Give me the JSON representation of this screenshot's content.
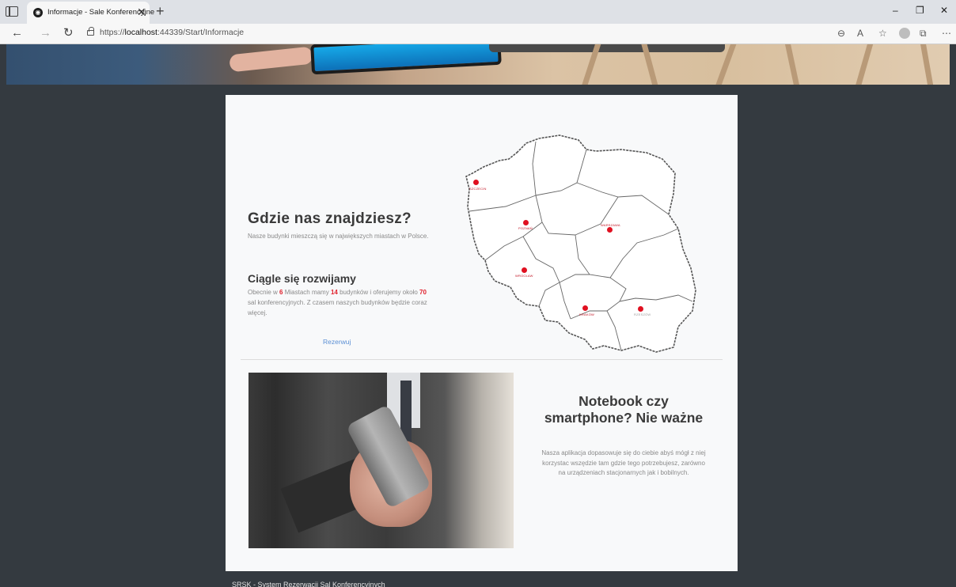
{
  "browser": {
    "tab_title": "Informacje - Sale Konferencyjne",
    "tab_close": "✕",
    "new_tab": "+",
    "url_prefix": "https://",
    "url_host": "localhost",
    "url_path": ":44339/Start/Informacje",
    "window_controls": {
      "minimize": "–",
      "restore": "❐",
      "close": "✕"
    },
    "toolbar_icons": [
      "zoom-icon",
      "read-aloud-icon",
      "favorites-icon",
      "collections-icon",
      "profile-icon",
      "more-icon"
    ]
  },
  "info": {
    "heading": "Gdzie nas znajdziesz?",
    "description": "Nasze budynki mieszczą się w największych miastach w Polsce.",
    "growth_heading": "Ciągle się rozwijamy",
    "growth_text": {
      "part1": "Obecnie w ",
      "cities_count": "6",
      "part2": " Miastach mamy ",
      "buildings_count": "14",
      "part3": " budynków i oferujemy około ",
      "rooms_count": "70",
      "part4": " sal konferencyjnych. Z czasem naszych budynków będzie coraz więcej."
    },
    "reserve_link": "Rezerwuj"
  },
  "map": {
    "cities": [
      "SZCZECIN",
      "POZNAŃ",
      "WARSZAWA",
      "WROCŁAW",
      "KRAKÓW",
      "RZESZÓW"
    ]
  },
  "device": {
    "heading": "Notebook czy smartphone? Nie ważne",
    "text": "Nasza aplikacja dopasowuje się do ciebie abyś mógł z niej korzystac wszędzie tam gdzie tego potrzebujesz, zarówno na urządzeniach stacjonarnych jak i bobilnych."
  },
  "footer": {
    "text": "SRSK - System Rezerwacji Sal Konferencyjnych"
  },
  "colors": {
    "page_bg": "#343a40",
    "card_bg": "#f8f9fa",
    "highlight": "#e0202c",
    "link": "#5b8fd4"
  }
}
